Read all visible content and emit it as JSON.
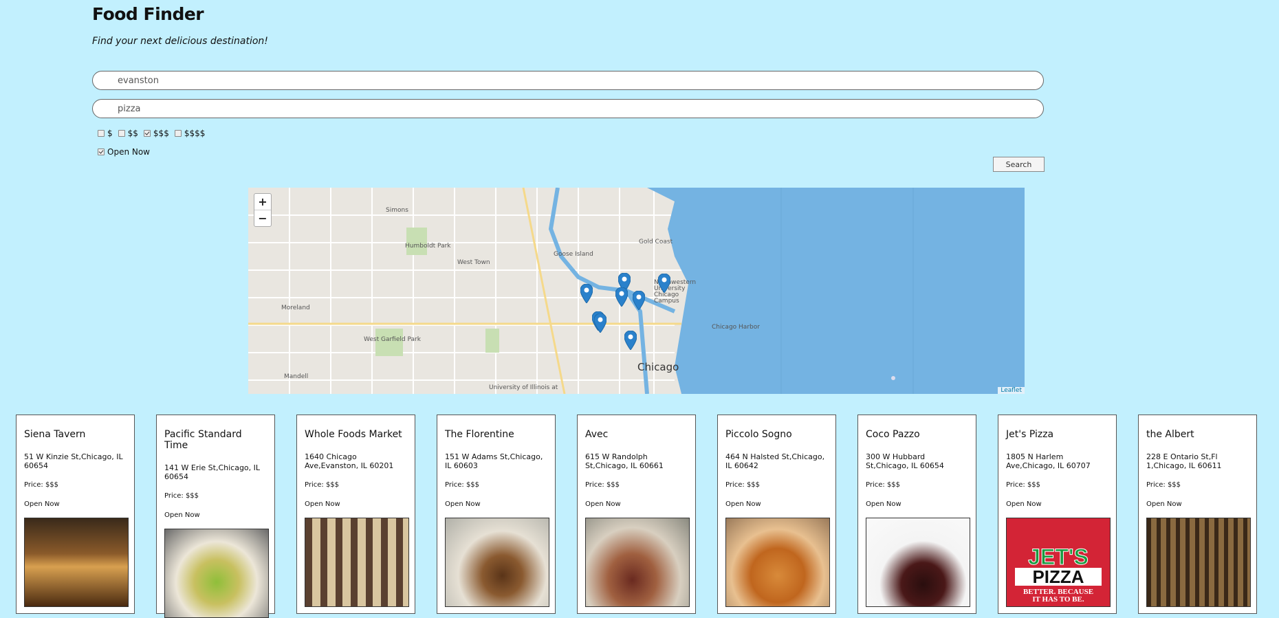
{
  "header": {
    "title": "Food Finder",
    "subtitle": "Find your next delicious destination!"
  },
  "search": {
    "location_value": "evanston",
    "term_value": "pizza",
    "button_label": "Search"
  },
  "filters": {
    "prices": [
      {
        "label": "$",
        "checked": false
      },
      {
        "label": "$$",
        "checked": false
      },
      {
        "label": "$$$",
        "checked": true
      },
      {
        "label": "$$$$",
        "checked": false
      }
    ],
    "open_now": {
      "label": "Open Now",
      "checked": true
    }
  },
  "map": {
    "zoom_in": "+",
    "zoom_out": "−",
    "attribution": "Leaflet",
    "labels": {
      "chicago": "Chicago",
      "simons": "Simons",
      "humboldt_park": "Humboldt Park",
      "west_town": "West Town",
      "goose_island": "Goose Island",
      "gold_coast": "Gold Coast",
      "moreland": "Moreland",
      "west_garfield_park": "West Garfield Park",
      "mandell": "Mandell",
      "chicago_harbor": "Chicago Harbor",
      "northwestern": "Northwestern University Chicago Campus",
      "university_of_illinois": "University of Illinois at"
    }
  },
  "colors": {
    "background": "#c2f0fe",
    "water": "#74b3e2",
    "marker": "#2a81cb"
  },
  "restaurants": [
    {
      "name": "Siena Tavern",
      "address": "51 W Kinzie St,Chicago, IL 60654",
      "price": "Price: $$$",
      "status": "Open Now",
      "image": "restaurant-interior"
    },
    {
      "name": "Pacific Standard Time",
      "address": "141 W Erie St,Chicago, IL 60654",
      "price": "Price: $$$",
      "status": "Open Now",
      "image": "salad-plate"
    },
    {
      "name": "Whole Foods Market",
      "address": "1640 Chicago Ave,Evanston, IL 60201",
      "price": "Price: $$$",
      "status": "Open Now",
      "image": "pastry-case"
    },
    {
      "name": "The Florentine",
      "address": "151 W Adams St,Chicago, IL 60603",
      "price": "Price: $$$",
      "status": "Open Now",
      "image": "fish-dish"
    },
    {
      "name": "Avec",
      "address": "615 W Randolph St,Chicago, IL 60661",
      "price": "Price: $$$",
      "status": "Open Now",
      "image": "meat-dish"
    },
    {
      "name": "Piccolo Sogno",
      "address": "464 N Halsted St,Chicago, IL 60642",
      "price": "Price: $$$",
      "status": "Open Now",
      "image": "pasta-bowl"
    },
    {
      "name": "Coco Pazzo",
      "address": "300 W Hubbard St,Chicago, IL 60654",
      "price": "Price: $$$",
      "status": "Open Now",
      "image": "chocolate-dessert"
    },
    {
      "name": "Jet's Pizza",
      "address": "1805 N Harlem Ave,Chicago, IL 60707",
      "price": "Price: $$$",
      "status": "Open Now",
      "image": "jets-pizza-logo",
      "logo_line1": "JET'S",
      "logo_line2": "PIZZA",
      "logo_line3": "BETTER. BECAUSE",
      "logo_line4": "IT HAS TO BE."
    },
    {
      "name": "the Albert",
      "address": "228 E Ontario St,Fl 1,Chicago, IL 60611",
      "price": "Price: $$$",
      "status": "Open Now",
      "image": "bar-shelves"
    }
  ]
}
